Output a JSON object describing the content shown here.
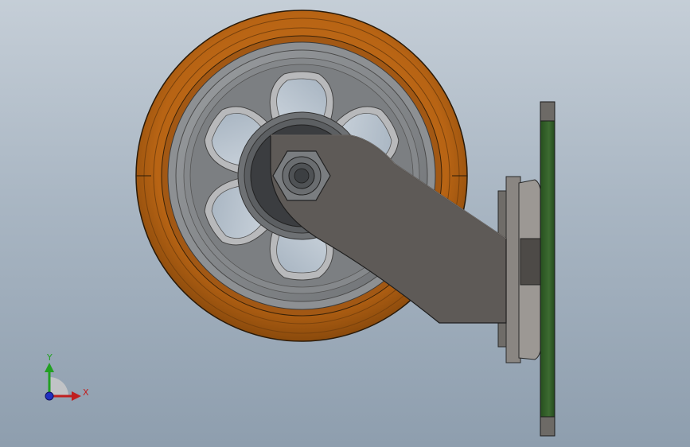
{
  "viewport": {
    "background_top": "#c5ced7",
    "background_bottom": "#8e9eae"
  },
  "model": {
    "tire_color": "#c06a1c",
    "tire_dark": "#6d3a0a",
    "hub_color": "#7e8184",
    "bracket_color": "#5e5a57",
    "plate_color": "#2f5a26"
  },
  "triad": {
    "y_label": "Y",
    "x_label": "X",
    "y_color": "#22a022",
    "x_color": "#c02020",
    "z_color": "#2030c0",
    "x_icon": "x-axis-arrow-icon",
    "y_icon": "y-axis-arrow-icon",
    "z_icon": "z-axis-origin-icon"
  }
}
